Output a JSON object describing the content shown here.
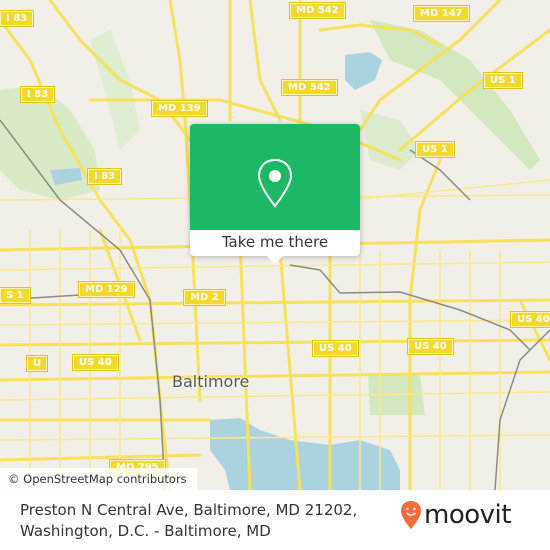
{
  "map": {
    "city_label": "Baltimore",
    "road_shields": [
      {
        "id": "i83-top-left",
        "label": "I 83"
      },
      {
        "id": "md542-top",
        "label": "MD 542"
      },
      {
        "id": "md147",
        "label": "MD 147"
      },
      {
        "id": "md542-mid",
        "label": "MD 542"
      },
      {
        "id": "i83-mid",
        "label": "I 83"
      },
      {
        "id": "md139",
        "label": "MD 139"
      },
      {
        "id": "us1-right-top",
        "label": "US 1"
      },
      {
        "id": "us1-center",
        "label": "US 1"
      },
      {
        "id": "i83-lower",
        "label": "I 83"
      },
      {
        "id": "md129",
        "label": "MD 129"
      },
      {
        "id": "md2",
        "label": "MD 2"
      },
      {
        "id": "us1-left",
        "label": "S 1"
      },
      {
        "id": "us40-far-left",
        "label": "U"
      },
      {
        "id": "us40-left",
        "label": "US 40"
      },
      {
        "id": "us40-center",
        "label": "US 40"
      },
      {
        "id": "us40-center-right",
        "label": "US 40"
      },
      {
        "id": "us40-right",
        "label": "US 40"
      },
      {
        "id": "us1-far-right",
        "label": "US 1"
      },
      {
        "id": "md295",
        "label": "MD 295"
      }
    ],
    "colors": {
      "land": "#f2efe9",
      "road": "#f6e15a",
      "park": "#d4e8c0",
      "water": "#aad3df",
      "rail": "#888888"
    }
  },
  "popup": {
    "cta_label": "Take me there",
    "color": "#1db865"
  },
  "attribution": "© OpenStreetMap contributors",
  "footer": {
    "address_line1": "Preston N Central Ave, Baltimore, MD 21202,",
    "address_line2": "Washington, D.C. - Baltimore, MD",
    "brand": "moovit",
    "brand_color": "#f26c3c"
  }
}
